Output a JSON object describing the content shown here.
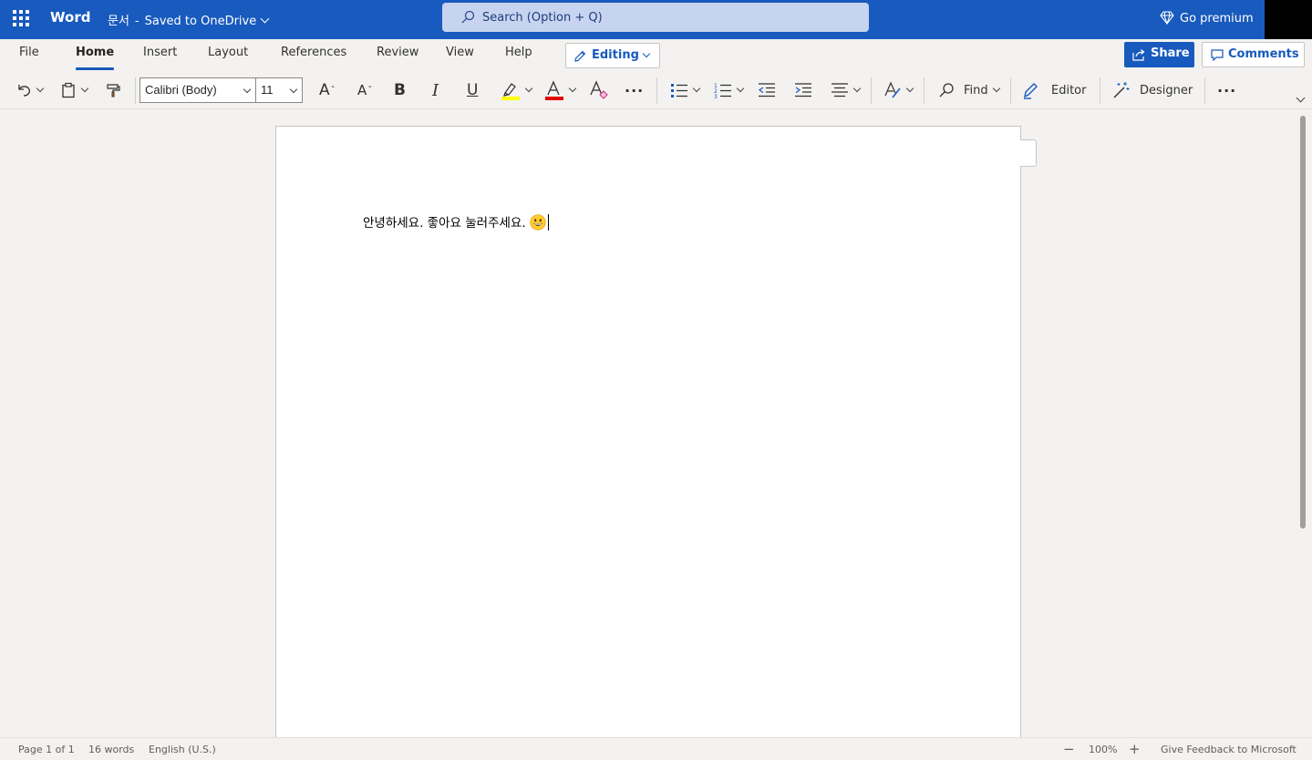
{
  "titlebar": {
    "app_name": "Word",
    "doc_name": "문서",
    "separator": "-",
    "save_status": "Saved to OneDrive",
    "search_placeholder": "Search (Option + Q)",
    "premium_label": "Go premium"
  },
  "tabs": [
    {
      "label": "File"
    },
    {
      "label": "Home"
    },
    {
      "label": "Insert"
    },
    {
      "label": "Layout"
    },
    {
      "label": "References"
    },
    {
      "label": "Review"
    },
    {
      "label": "View"
    },
    {
      "label": "Help"
    }
  ],
  "active_tab": "Home",
  "editing_label": "Editing",
  "share_label": "Share",
  "comments_label": "Comments",
  "toolbar": {
    "font_name": "Calibri (Body)",
    "font_size": "11",
    "grow_glyph": "A",
    "shrink_glyph": "A",
    "bold_glyph": "B",
    "italic_glyph": "I",
    "underline_glyph": "U",
    "more_glyph": "···",
    "find_label": "Find",
    "editor_label": "Editor",
    "designer_label": "Designer",
    "highlight_color": "#ffff00",
    "font_color": "#e00000",
    "accent": "#185abd"
  },
  "document": {
    "text": "안녕하세요. 좋아요 눌러주세요.",
    "emoji": "grinning-face"
  },
  "status": {
    "page": "Page 1 of 1",
    "words": "16 words",
    "language": "English (U.S.)",
    "zoom": "100%",
    "zoom_out": "−",
    "zoom_in": "+",
    "feedback": "Give Feedback to Microsoft"
  }
}
